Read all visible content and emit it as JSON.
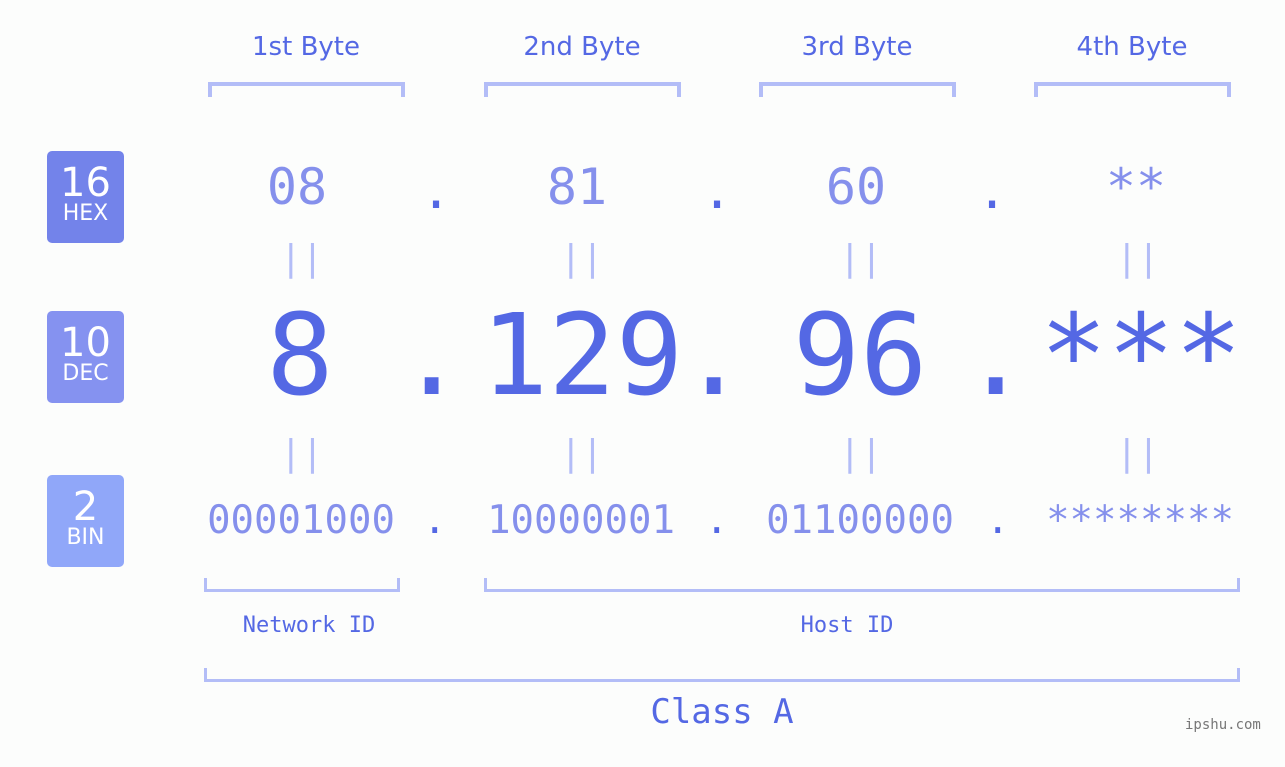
{
  "bases": [
    {
      "num": "16",
      "label": "HEX",
      "color": "#7383ea"
    },
    {
      "num": "10",
      "label": "DEC",
      "color": "#8592f0"
    },
    {
      "num": "2",
      "label": "BIN",
      "color": "#90a7f9"
    }
  ],
  "bytes": [
    {
      "header": "1st Byte",
      "hex": "08",
      "dec": "8",
      "bin": "00001000"
    },
    {
      "header": "2nd Byte",
      "hex": "81",
      "dec": "129",
      "bin": "10000001"
    },
    {
      "header": "3rd Byte",
      "hex": "60",
      "dec": "96",
      "bin": "01100000"
    },
    {
      "header": "4th Byte",
      "hex": "**",
      "dec": "***",
      "bin": "********"
    }
  ],
  "separator": ".",
  "equals": "||",
  "network_label": "Network ID",
  "host_label": "Host ID",
  "class_label": "Class A",
  "watermark": "ipshu.com",
  "colors": {
    "primary": "#5468e4",
    "secondary": "#8590ec",
    "bracket": "#b3bdf7"
  }
}
